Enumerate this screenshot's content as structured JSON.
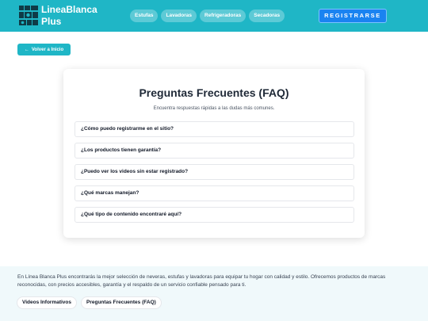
{
  "header": {
    "brand": "LineaBlanca Plus",
    "nav": [
      "Estufas",
      "Lavadoras",
      "Refrigeradoras",
      "Secadoras"
    ],
    "register_label": "REGISTRARSE"
  },
  "back_button": {
    "icon": "arrow-left-icon",
    "label": "Volver a Inicio"
  },
  "faq": {
    "title": "Preguntas Frecuentes (FAQ)",
    "subtitle": "Encuentra respuestas rápidas a las dudas más comunes.",
    "questions": [
      "¿Cómo puedo registrarme en el sitio?",
      "¿Los productos tienen garantía?",
      "¿Puedo ver los videos sin estar registrado?",
      "¿Qué marcas manejan?",
      "¿Qué tipo de contenido encontraré aquí?"
    ]
  },
  "footer": {
    "description": "En Línea Blanca Plus encontrarás la mejor selección de neveras, estufas y lavadoras para equipar tu hogar con calidad y estilo. Ofrecemos productos de marcas reconocidas, con precios accesibles, garantía y el respaldo de un servicio confiable pensado para ti.",
    "links": [
      "Videos Informativos",
      "Preguntas Frecuentes (FAQ)"
    ]
  },
  "colors": {
    "primary": "#1fb6c6",
    "accent": "#1a83f1",
    "footer_bg": "#f0f9fb"
  }
}
